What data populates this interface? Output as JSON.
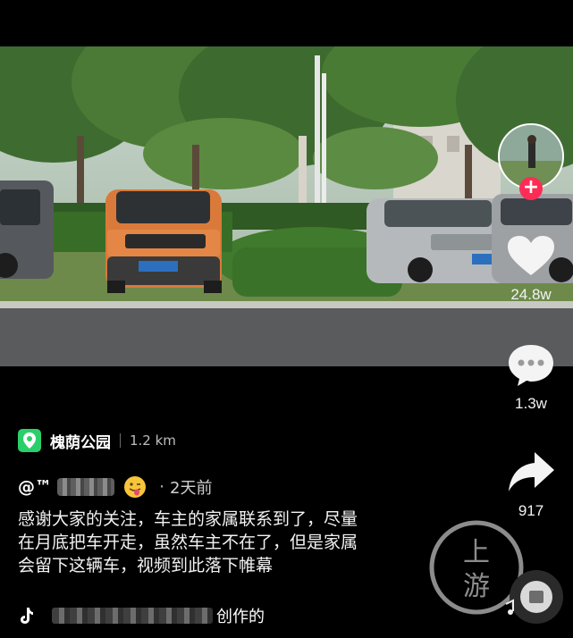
{
  "location": {
    "name": "槐荫公园",
    "distance": "1.2 km"
  },
  "author": {
    "handle": "@™",
    "time": "2天前"
  },
  "caption_lines": [
    "感谢大家的关注，车主的家属联系到了，尽量",
    "在月底把车开走，虽然车主不在了，但是家属",
    "会留下这辆车，视频到此落下帷幕"
  ],
  "music": {
    "suffix": "创作的"
  },
  "actions": {
    "likes": "24.8w",
    "comments": "1.3w",
    "shares": "917"
  },
  "follow": {
    "label": "+"
  },
  "watermark": {
    "top": "上",
    "bottom": "游"
  },
  "colors": {
    "accent_red": "#ff2c55",
    "location_green": "#2bcf6a",
    "background": "#000000"
  }
}
